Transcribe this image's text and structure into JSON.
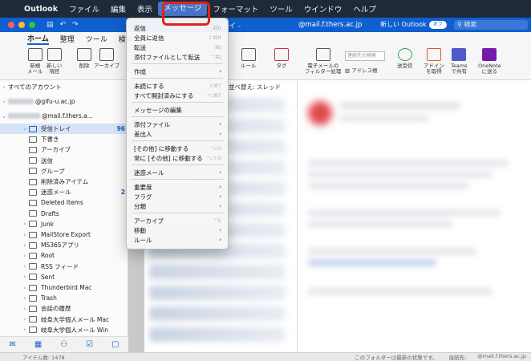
{
  "menubar": {
    "apple": "",
    "items": [
      "Outlook",
      "ファイル",
      "編集",
      "表示",
      "メッセージ",
      "フォーマット",
      "ツール",
      "ウインドウ",
      "ヘルプ"
    ]
  },
  "titlebar": {
    "title_fragment": "レイ -",
    "account": "@mail.f.thers.ac.jp",
    "new_outlook": "新しい Outlook",
    "toggle": "オフ",
    "search_placeholder": "検索"
  },
  "ribbon": {
    "tabs": [
      "ホーム",
      "整理",
      "ツール",
      "検索"
    ],
    "buttons": {
      "new_mail": "新規\nメール",
      "new_items": "新しい\n項目",
      "delete": "削除",
      "archive": "アーカイブ",
      "rules": "ルール",
      "tags": "タグ",
      "filter": "電子メールの\nフィルター処理",
      "address_book": "アドレス帳",
      "send_receive": "送受信",
      "addins": "アドイン\nを取得",
      "teams": "Teams\nで共有",
      "onenote": "OneNote\nに送る"
    },
    "search_contacts_placeholder": "連絡先の検索"
  },
  "sidebar": {
    "all_accounts": "すべてのアカウント",
    "account1": "@gifu-u.ac.jp",
    "account2": "@mail.f.thers.a...",
    "folders": [
      {
        "label": "受信トレイ",
        "count": "96"
      },
      {
        "label": "下書き",
        "count": ""
      },
      {
        "label": "アーカイブ",
        "count": ""
      },
      {
        "label": "送信",
        "count": ""
      },
      {
        "label": "グループ",
        "count": ""
      },
      {
        "label": "削除済みアイテム",
        "count": ""
      },
      {
        "label": "迷惑メール",
        "count": "2"
      },
      {
        "label": "Deleted Items",
        "count": ""
      },
      {
        "label": "Drafts",
        "count": ""
      },
      {
        "label": "Junk",
        "count": ""
      },
      {
        "label": "MailStore Export",
        "count": ""
      },
      {
        "label": "MS365アプリ",
        "count": ""
      },
      {
        "label": "Root",
        "count": ""
      },
      {
        "label": "RSS フィード",
        "count": ""
      },
      {
        "label": "Sent",
        "count": ""
      },
      {
        "label": "Thunderbird Mac",
        "count": ""
      },
      {
        "label": "Trash",
        "count": ""
      },
      {
        "label": "会話の履歴",
        "count": ""
      },
      {
        "label": "岐阜大学個人メール Mac",
        "count": ""
      },
      {
        "label": "岐阜大学個人メール Win",
        "count": ""
      }
    ]
  },
  "msglist": {
    "sort_label": "並べ替え: スレッド"
  },
  "dropdown": {
    "items": [
      {
        "label": "返信",
        "shortcut": "⌘R"
      },
      {
        "label": "全員に返信",
        "shortcut": "⇧⌘R"
      },
      {
        "label": "転送",
        "shortcut": "⌘J"
      },
      {
        "label": "添付ファイルとして転送",
        "shortcut": "^⌘J"
      },
      {
        "label": "作成",
        "shortcut": ""
      },
      {
        "label": "未読にする",
        "shortcut": "⇧⌘T"
      },
      {
        "label": "すべて開封済みにする",
        "shortcut": "⌥⌘T"
      },
      {
        "label": "メッセージの編集",
        "shortcut": ""
      },
      {
        "label": "添付ファイル",
        "shortcut": ""
      },
      {
        "label": "差出人",
        "shortcut": ""
      },
      {
        "label": "[その他] に移動する",
        "shortcut": "⌥O"
      },
      {
        "label": "常に [その他] に移動する",
        "shortcut": "⌥⇧O"
      },
      {
        "label": "迷惑メール",
        "shortcut": ""
      },
      {
        "label": "重要度",
        "shortcut": ""
      },
      {
        "label": "フラグ",
        "shortcut": ""
      },
      {
        "label": "分類",
        "shortcut": ""
      },
      {
        "label": "アーカイブ",
        "shortcut": "^E"
      },
      {
        "label": "移動",
        "shortcut": ""
      },
      {
        "label": "ルール",
        "shortcut": ""
      }
    ]
  },
  "statusbar": {
    "items_count": "アイテム数: 1478",
    "folder_status": "このフォルダーは最新の状態です。",
    "connected_to": "接続先:",
    "account": "@mail.f.thers.ac.jp"
  },
  "colors": {
    "titlebar": "#0f5fcf",
    "highlight": "#e2231a",
    "menubar_active": "#4a76c9"
  }
}
